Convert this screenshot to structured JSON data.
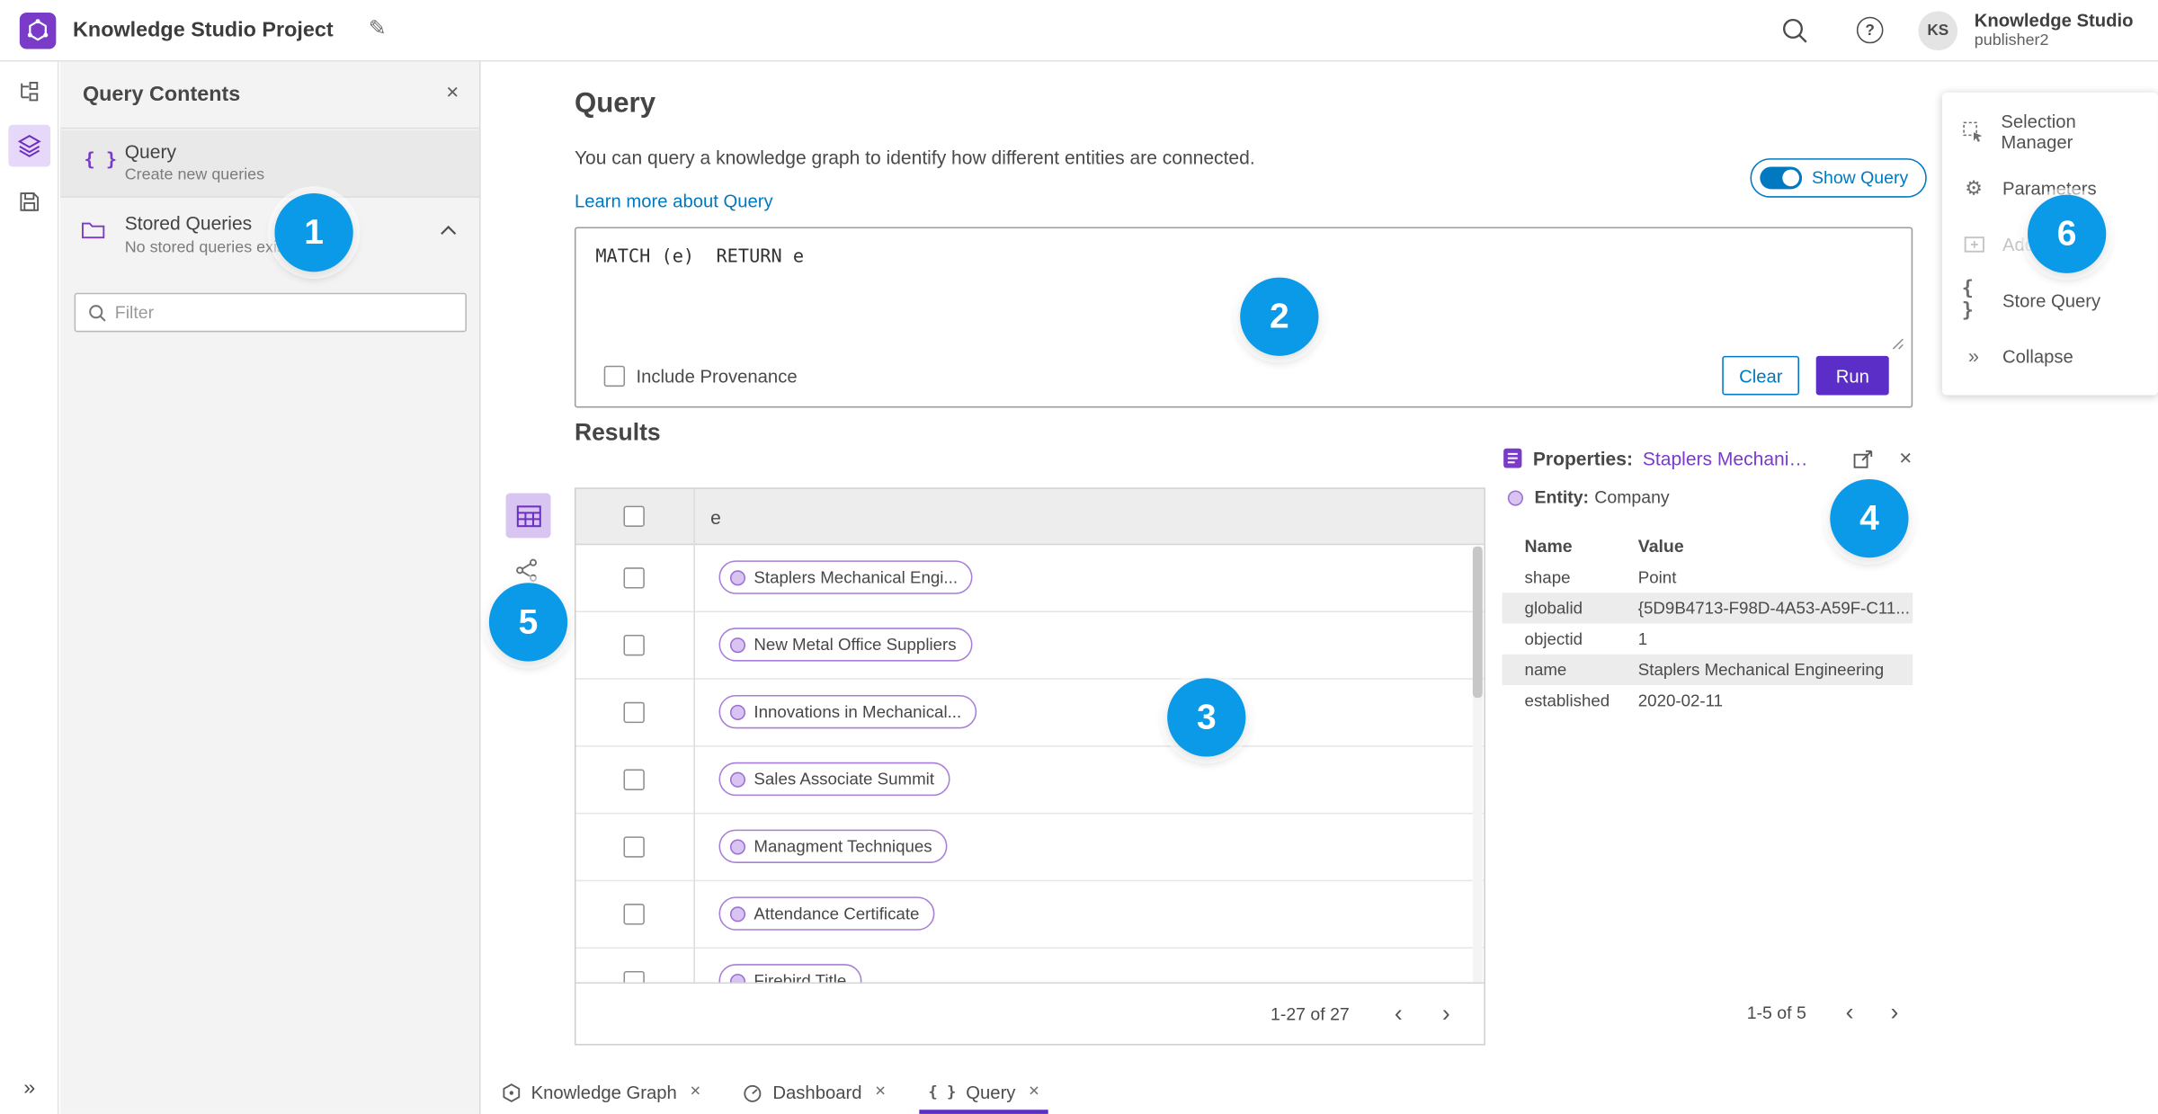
{
  "colors": {
    "accent_blue": "#0079c1",
    "accent_purple": "#7a3cc8",
    "run_button": "#5b2fc7",
    "badge_blue": "#0a9ae8",
    "selected_rail_bg": "#e6d8f8"
  },
  "icons": {
    "edit": "✎",
    "help": "?",
    "close": "✕",
    "braces": "{ }",
    "collapse": "»",
    "chevron_left": "‹",
    "chevron_right": "›",
    "gear": "⚙"
  },
  "topbar": {
    "title": "Knowledge Studio Project",
    "user_name": "Knowledge Studio",
    "user_role": "publisher2",
    "avatar_initials": "KS"
  },
  "left_panel": {
    "title": "Query Contents",
    "query_item_title": "Query",
    "query_item_subtitle": "Create new queries",
    "stored_title": "Stored Queries",
    "stored_subtitle": "No stored queries exist",
    "filter_placeholder": "Filter"
  },
  "query_panel": {
    "title": "Query",
    "description": "You can query a knowledge graph to identify how different entities are connected.",
    "learn_more": "Learn more about Query",
    "show_query": "Show Query",
    "query_text": "MATCH (e)  RETURN e",
    "include_provenance": "Include Provenance",
    "clear": "Clear",
    "run": "Run"
  },
  "results": {
    "title": "Results",
    "column_e": "e",
    "rows": [
      "Staplers Mechanical Engi...",
      "New Metal Office Suppliers",
      "Innovations in Mechanical...",
      "Sales Associate Summit",
      "Managment Techniques",
      "Attendance Certificate",
      "Firebird Title"
    ],
    "pagination": "1-27 of 27"
  },
  "properties": {
    "label": "Properties:",
    "link": "Staplers Mechanic...",
    "entity_label": "Entity:",
    "entity_value": "Company",
    "col_name": "Name",
    "col_value": "Value",
    "rows": [
      [
        "shape",
        "Point"
      ],
      [
        "globalid",
        "{5D9B4713-F98D-4A53-A59F-C11..."
      ],
      [
        "objectid",
        "1"
      ],
      [
        "name",
        "Staplers Mechanical Engineering"
      ],
      [
        "established",
        "2020-02-11"
      ]
    ],
    "pagination": "1-5 of 5"
  },
  "side_menu": {
    "items": [
      "Selection Manager",
      "Parameters",
      "Add To Map",
      "Store Query",
      "Collapse"
    ]
  },
  "tabs": [
    {
      "label": "Knowledge Graph"
    },
    {
      "label": "Dashboard"
    },
    {
      "label": "Query"
    }
  ],
  "badges": [
    "1",
    "2",
    "3",
    "4",
    "5",
    "6"
  ]
}
